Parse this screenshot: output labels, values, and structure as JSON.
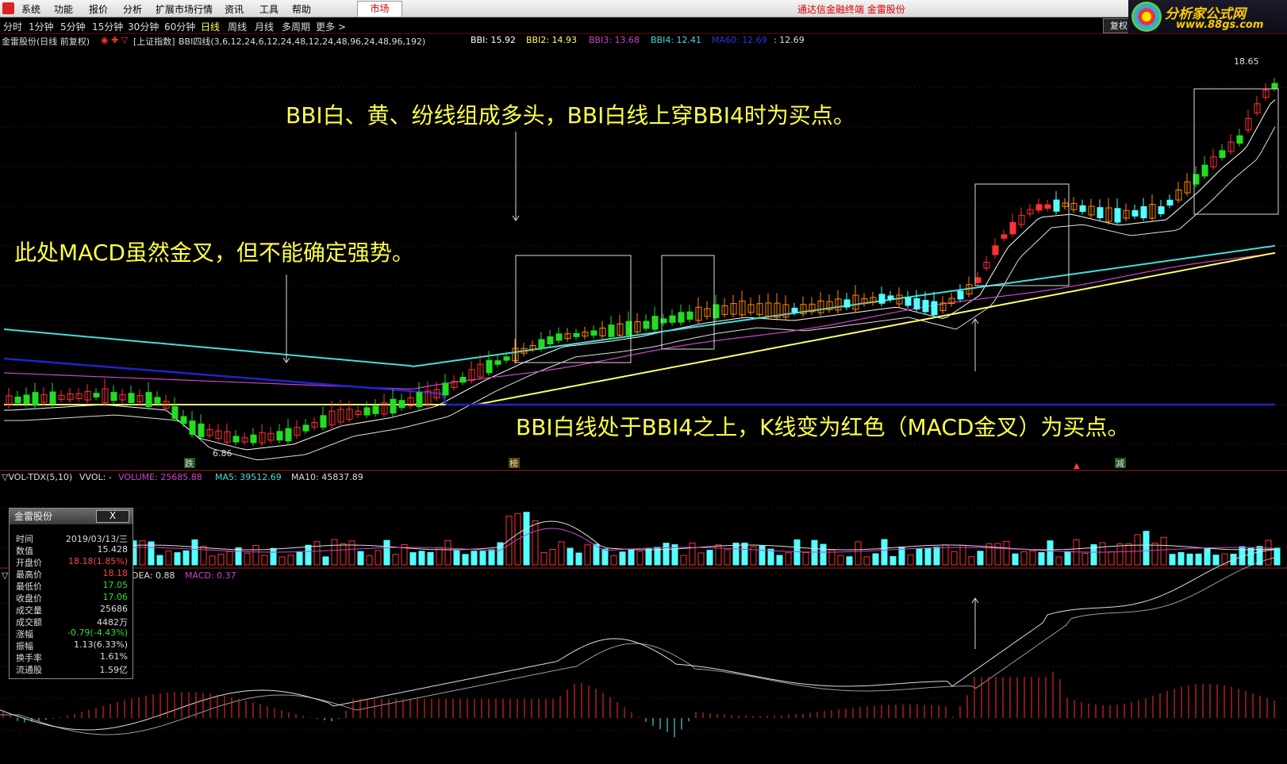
{
  "menubar": {
    "items": [
      "系统",
      "功能",
      "报价",
      "分析",
      "扩展市场行情",
      "资讯",
      "工具",
      "帮助"
    ],
    "market_button": "市场",
    "brand": "通达信金融终端 金雷股份"
  },
  "tabs": {
    "items": [
      "分时",
      "1分钟",
      "5分钟",
      "15分钟",
      "30分钟",
      "60分钟",
      "日线",
      "周线",
      "月线",
      "多周期",
      "更多 >"
    ],
    "active": "日线",
    "fuquan": "复权"
  },
  "site_logo": {
    "name": "分析家公式网",
    "url": "www.88gs.com"
  },
  "main_header": {
    "stock": "金雷股份(日线 前复权)",
    "ref_index": "[上证指数]",
    "indicator": "BBI四线(3,6,12,24,6,12,24,48,12,24,48,96,24,48,96,192)",
    "bbi": "BBI: 15.92",
    "bbi2": "BBI2: 14.93",
    "bbi3": "BBI3: 13.68",
    "bbi4": "BBI4: 12.41",
    "ma60": "MA60: 12.69",
    "extra": ": 12.69"
  },
  "price_labels": {
    "high": "18.65",
    "low": "6.86"
  },
  "markers": {
    "die": "跌",
    "bang": "榜",
    "jian": "减"
  },
  "annotations": {
    "top": "BBI白、黄、纷线组成多头，BBI白线上穿BBI4时为买点。",
    "left": "此处MACD虽然金叉，但不能确定强势。",
    "bottom": "BBI白线处于BBI4之上，K线变为红色（MACD金叉）为买点。"
  },
  "vol_header": {
    "name": "VOL-TDX(5,10)",
    "vvol": "VVOL: -",
    "volume": "VOLUME: 25685.88",
    "ma5": "MA5: 39512.69",
    "ma10": "MA10: 45837.89"
  },
  "macd_header": {
    "dea": "DEA: 0.88",
    "macd": "MACD: 0.37"
  },
  "info_panel": {
    "title": "金雷股份",
    "close": "X",
    "rows": [
      {
        "k": "时间",
        "v": "2019/03/13/三",
        "c": "#dddddd"
      },
      {
        "k": "数值",
        "v": "15.428",
        "c": "#dddddd"
      },
      {
        "k": "开盘价",
        "v": "18.18(1.85%)",
        "c": "#ff4444"
      },
      {
        "k": "最高价",
        "v": "18.18",
        "c": "#ff4444"
      },
      {
        "k": "最低价",
        "v": "17.05",
        "c": "#33dd33"
      },
      {
        "k": "收盘价",
        "v": "17.06",
        "c": "#33dd33"
      },
      {
        "k": "成交量",
        "v": "25686",
        "c": "#dddddd"
      },
      {
        "k": "成交额",
        "v": "4482万",
        "c": "#dddddd"
      },
      {
        "k": "涨幅",
        "v": "-0.79(-4.43%)",
        "c": "#33dd33"
      },
      {
        "k": "振幅",
        "v": "1.13(6.33%)",
        "c": "#dddddd"
      },
      {
        "k": "换手率",
        "v": "1.61%",
        "c": "#dddddd"
      },
      {
        "k": "流通股",
        "v": "1.59亿",
        "c": "#dddddd"
      }
    ]
  },
  "colors": {
    "up": "#ff3232",
    "down": "#54ffff",
    "annotation": "#ffff44",
    "bbi": "#ffffff",
    "bbi2": "#ffff66",
    "bbi3": "#cc44cc",
    "bbi4": "#44dddd",
    "ma60": "#2222cc"
  }
}
